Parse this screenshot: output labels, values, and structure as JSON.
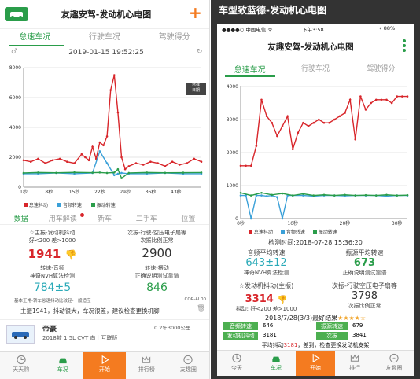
{
  "left": {
    "title": "友趣安驾-发动机心电图",
    "plus": "+",
    "tabs": [
      "怠速车况",
      "行驶车况",
      "驾驶得分"
    ],
    "timestamp": "2019-01-15 19:52:25",
    "select_btn": "选择\n日期",
    "legend": [
      "怠速抖动",
      "音频转速",
      "振动转速"
    ],
    "subtabs": [
      "数据",
      "用车解读",
      "新车",
      "二手车",
      "位置"
    ],
    "metrics": {
      "m1_title": "☆主振-发动机抖动",
      "m1_sub": "好<200 差>1000",
      "m1_value": "1941",
      "m2_title": "次振-行驶-空压电子扇等",
      "m2_sub": "次振比例正常",
      "m2_value": "2900",
      "m3_title": "转速-音频",
      "m3_sub": "神奇NVH算法检测",
      "m3_value": "784±5",
      "m4_title": "转速-振动",
      "m4_sub": "正确说明测试靠谱",
      "m4_value": "846"
    },
    "note_left": "基本正常-轿车怠速抖动比较轻-一般适应",
    "note_right": "COR-AL00",
    "advice": "主振1941，抖动很大，车况很差，建议检查更换机脚",
    "car_name": "帝豪",
    "car_detail": "2018款 1.5L CVT 向上互联版",
    "car_price": "0.2年3000公里",
    "bottom_tabs": [
      "天天购",
      "车况",
      "开始",
      "排行榜",
      "友趣圈"
    ]
  },
  "right": {
    "header": "车型致蓝德-发动机心电图",
    "status_carrier": "●●●●○ 中国电信 ᯤ",
    "status_time": "下午3:58",
    "status_battery": "⌖ 88%",
    "title": "友趣安驾-发动机心电图",
    "tabs": [
      "怠速车况",
      "行驶车况",
      "驾驶得分"
    ],
    "legend": [
      "怠速抖动",
      "音频转速",
      "振动转速"
    ],
    "detect_time": "检测时间:2018-07-28 15:36:20",
    "m1_title": "音频平均转速",
    "m1_value": "643±12",
    "m1_sub": "神奇NVH算法检测",
    "m2_title": "振源平均转速",
    "m2_value": "673",
    "m2_sub": "正确说明测试靠谱",
    "m3_title": "☆发动机抖动(主振)",
    "m3_value": "3314",
    "m3_sub": "抖动: 好<200 差>1000",
    "m4_title": "次振-行驶空压电子扇等",
    "m4_value": "3798",
    "m4_sub": "次振比例正常",
    "best_line": "2018/7/28(3/3)最好结果",
    "stars": "★★★★☆",
    "rows": [
      {
        "k1": "音频转速",
        "v1": "646",
        "k2": "振源转速",
        "v2": "679"
      },
      {
        "k1": "发动机抖动",
        "v1": "3181",
        "k2": "次振",
        "v2": "3841"
      }
    ],
    "advice_a": "平均抖动",
    "advice_num": "3181",
    "advice_b": "，差到，检查更换发动机支架",
    "bottom_tabs": [
      "今天",
      "车况",
      "开始",
      "排行",
      "友趣圈"
    ]
  },
  "chart_data": [
    {
      "type": "line",
      "x_ticks": [
        "1秒",
        "8秒",
        "15秒",
        "22秒",
        "29秒",
        "36秒",
        "43秒"
      ],
      "y_ticks": [
        "0",
        "2000",
        "4000",
        "6000",
        "8000"
      ],
      "ylim": [
        0,
        8000
      ],
      "xlim": [
        1,
        50
      ],
      "series": [
        {
          "name": "怠速抖动",
          "color": "#d8262b",
          "x": [
            1,
            3,
            5,
            7,
            9,
            11,
            13,
            15,
            17,
            18,
            19,
            20,
            21,
            22,
            23,
            24,
            25,
            26,
            27,
            28,
            29,
            30,
            32,
            34,
            36,
            38,
            40,
            42,
            44,
            46,
            48,
            50
          ],
          "y": [
            1800,
            1700,
            1900,
            1600,
            1800,
            1900,
            1700,
            1600,
            2200,
            2000,
            1800,
            2700,
            1900,
            3000,
            2800,
            3400,
            6500,
            7500,
            5000,
            2000,
            1200,
            1400,
            1600,
            1500,
            1700,
            1600,
            1400,
            1700,
            1500,
            1600,
            1900,
            1700
          ]
        },
        {
          "name": "音频转速",
          "color": "#3aa0d8",
          "x": [
            1,
            5,
            10,
            15,
            20,
            22,
            24,
            26,
            27,
            28,
            30,
            35,
            40,
            45,
            50
          ],
          "y": [
            900,
            900,
            950,
            900,
            950,
            2400,
            1600,
            800,
            900,
            950,
            900,
            900,
            950,
            900,
            900
          ]
        },
        {
          "name": "振动转速",
          "color": "#2a9d4a",
          "x": [
            1,
            5,
            10,
            15,
            20,
            22,
            24,
            26,
            27,
            28,
            30,
            35,
            40,
            45,
            50
          ],
          "y": [
            950,
            980,
            960,
            990,
            970,
            980,
            950,
            980,
            1200,
            600,
            950,
            980,
            960,
            970,
            980
          ]
        }
      ]
    },
    {
      "type": "line",
      "x_ticks": [
        "0秒",
        "10秒",
        "20秒",
        "30秒"
      ],
      "y_ticks": [
        "0",
        "1000",
        "2000",
        "3000",
        "4000"
      ],
      "ylim": [
        0,
        4000
      ],
      "xlim": [
        0,
        32
      ],
      "series": [
        {
          "name": "怠速抖动",
          "color": "#d8262b",
          "x": [
            0,
            1,
            2,
            3,
            4,
            5,
            6,
            7,
            8,
            9,
            10,
            11,
            12,
            13,
            14,
            15,
            16,
            17,
            18,
            19,
            20,
            21,
            22,
            23,
            24,
            25,
            26,
            27,
            28,
            29,
            30,
            31,
            32
          ],
          "y": [
            1600,
            1600,
            1600,
            2200,
            3600,
            3100,
            2900,
            2500,
            2800,
            3100,
            2100,
            2600,
            2900,
            2800,
            2900,
            3000,
            2900,
            2900,
            3000,
            3100,
            3200,
            3600,
            2400,
            3700,
            3300,
            3500,
            3600,
            3600,
            3600,
            3500,
            3700,
            3700,
            3700
          ]
        },
        {
          "name": "音频转速",
          "color": "#3aa0d8",
          "x": [
            0,
            1,
            2,
            3,
            4,
            5,
            6,
            7,
            8,
            9,
            10,
            12,
            14,
            16,
            18,
            20,
            22,
            24,
            26,
            28,
            30,
            32
          ],
          "y": [
            700,
            700,
            0,
            700,
            700,
            680,
            700,
            650,
            0,
            700,
            700,
            700,
            680,
            700,
            700,
            690,
            700,
            700,
            700,
            680,
            700,
            700
          ]
        },
        {
          "name": "振动转速",
          "color": "#2a9d4a",
          "x": [
            0,
            2,
            4,
            6,
            8,
            10,
            12,
            14,
            16,
            18,
            20,
            22,
            24,
            26,
            28,
            30,
            32
          ],
          "y": [
            780,
            700,
            780,
            720,
            760,
            700,
            750,
            700,
            720,
            700,
            720,
            700,
            710,
            700,
            720,
            700,
            710
          ]
        }
      ]
    }
  ]
}
